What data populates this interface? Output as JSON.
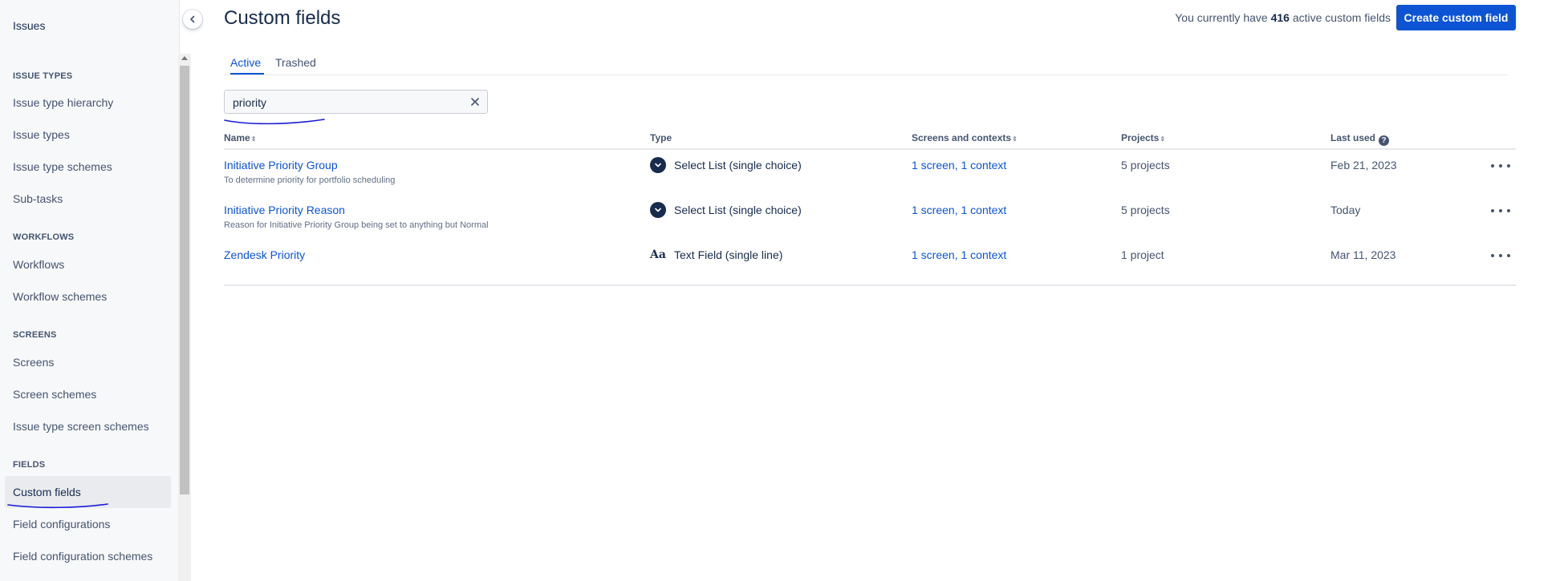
{
  "sidebar": {
    "title": "Issues",
    "sections": {
      "issue_types": "ISSUE TYPES",
      "workflows": "WORKFLOWS",
      "screens": "SCREENS",
      "fields": "FIELDS"
    },
    "items": [
      {
        "label": "Issue type hierarchy"
      },
      {
        "label": "Issue types"
      },
      {
        "label": "Issue type schemes"
      },
      {
        "label": "Sub-tasks"
      },
      {
        "label": "Workflows"
      },
      {
        "label": "Workflow schemes"
      },
      {
        "label": "Screens"
      },
      {
        "label": "Screen schemes"
      },
      {
        "label": "Issue type screen schemes"
      },
      {
        "label": "Custom fields",
        "selected": true
      },
      {
        "label": "Field configurations"
      },
      {
        "label": "Field configuration schemes"
      }
    ]
  },
  "header": {
    "title": "Custom fields",
    "info_prefix": "You currently have",
    "info_count": "416",
    "info_suffix": "active custom fields",
    "create_button": "Create custom field"
  },
  "tabs": [
    {
      "label": "Active",
      "active": true
    },
    {
      "label": "Trashed",
      "active": false
    }
  ],
  "search": {
    "value": "priority",
    "clear_icon": "close-icon"
  },
  "table": {
    "columns": {
      "name": "Name",
      "type": "Type",
      "screens": "Screens and contexts",
      "projects": "Projects",
      "last_used": "Last used"
    },
    "rows": [
      {
        "name": "Initiative Priority Group",
        "description": "To determine priority for portfolio scheduling",
        "type": "Select List (single choice)",
        "type_icon": "select-list-icon",
        "screens": "1 screen, 1 context",
        "projects": "5 projects",
        "last_used": "Feb 21, 2023"
      },
      {
        "name": "Initiative Priority Reason",
        "description": "Reason for Initiative Priority Group being set to anything but Normal",
        "type": "Select List (single choice)",
        "type_icon": "select-list-icon",
        "screens": "1 screen, 1 context",
        "projects": "5 projects",
        "last_used": "Today"
      },
      {
        "name": "Zendesk Priority",
        "description": "",
        "type": "Text Field (single line)",
        "type_icon": "text-field-icon",
        "type_glyph": "Aa",
        "screens": "1 screen, 1 context",
        "projects": "1 project",
        "last_used": "Mar 11, 2023"
      }
    ]
  },
  "colors": {
    "accent": "#0c54d4",
    "text": "#172b4d",
    "subtle_text": "#44546f",
    "sidebar_bg": "#f7f8f9",
    "annotation_ink": "#1a1ad8"
  }
}
